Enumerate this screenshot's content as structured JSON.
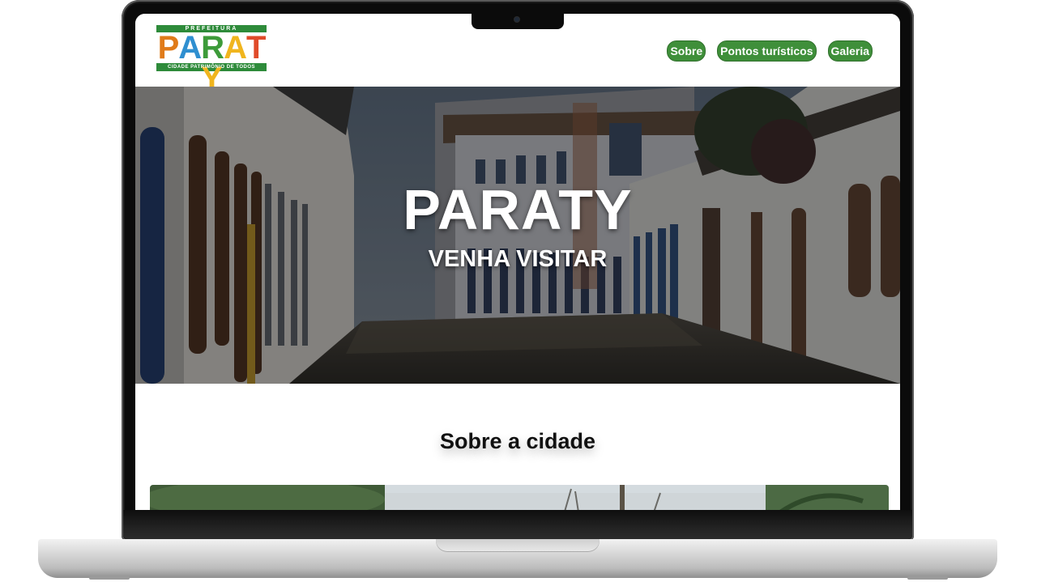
{
  "logo": {
    "top_text": "PREFEITURA",
    "letters": [
      "P",
      "A",
      "R",
      "A",
      "T",
      "Y"
    ],
    "letter_colors": [
      "#e07b1a",
      "#2f8fd0",
      "#3d9b3a",
      "#f0b51e",
      "#e04b2a",
      "#f0b51e"
    ],
    "bottom_text": "CIDADE PATRIMÔNIO DE TODOS",
    "green": "#2e8b3a"
  },
  "nav": {
    "items": [
      {
        "label": "Sobre"
      },
      {
        "label": "Pontos turísticos"
      },
      {
        "label": "Galeria"
      }
    ],
    "button_color": "#3f8f3a"
  },
  "hero": {
    "title": "PARATY",
    "subtitle": "VENHA VISITAR"
  },
  "about": {
    "title": "Sobre a cidade"
  }
}
